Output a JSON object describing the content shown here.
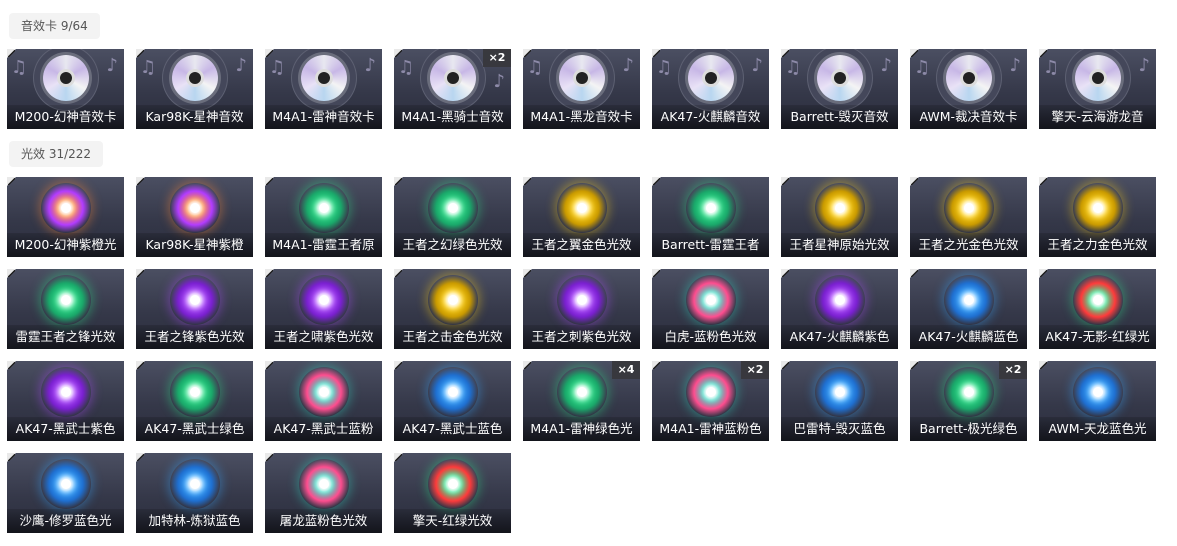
{
  "sections": [
    {
      "title": "音效卡 9/64",
      "kind": "sound",
      "items": [
        {
          "label": "M200-幻神音效卡",
          "badge": ""
        },
        {
          "label": "Kar98K-星神音效",
          "badge": ""
        },
        {
          "label": "M4A1-雷神音效卡",
          "badge": ""
        },
        {
          "label": "M4A1-黑骑士音效",
          "badge": "×2"
        },
        {
          "label": "M4A1-黑龙音效卡",
          "badge": ""
        },
        {
          "label": "AK47-火麒麟音效",
          "badge": ""
        },
        {
          "label": "Barrett-毁灭音效",
          "badge": ""
        },
        {
          "label": "AWM-裁决音效卡",
          "badge": ""
        },
        {
          "label": "擎天-云海游龙音",
          "badge": ""
        }
      ]
    },
    {
      "title": "光效 31/222",
      "kind": "light",
      "items": [
        {
          "label": "M200-幻神紫橙光",
          "badge": "",
          "color": "#ff8a3c",
          "color2": "#b23cff"
        },
        {
          "label": "Kar98K-星神紫橙",
          "badge": "",
          "color": "#ff8a3c",
          "color2": "#b23cff"
        },
        {
          "label": "M4A1-雷霆王者原",
          "badge": "",
          "color": "#2fe08a",
          "color2": "#1aa86a"
        },
        {
          "label": "王者之幻绿色光效",
          "badge": "",
          "color": "#2fe08a",
          "color2": "#1aa86a"
        },
        {
          "label": "王者之翼金色光效",
          "badge": "",
          "color": "#ffd21a",
          "color2": "#c99a00"
        },
        {
          "label": "Barrett-雷霆王者",
          "badge": "",
          "color": "#2fe08a",
          "color2": "#1aa86a"
        },
        {
          "label": "王者星神原始光效",
          "badge": "",
          "color": "#ffd21a",
          "color2": "#c99a00"
        },
        {
          "label": "王者之光金色光效",
          "badge": "",
          "color": "#ffd21a",
          "color2": "#c99a00"
        },
        {
          "label": "王者之力金色光效",
          "badge": "",
          "color": "#ffd21a",
          "color2": "#c99a00"
        },
        {
          "label": "雷霆王者之锋光效",
          "badge": "",
          "color": "#2fe08a",
          "color2": "#1aa86a"
        },
        {
          "label": "王者之锋紫色光效",
          "badge": "",
          "color": "#b04dff",
          "color2": "#7a20d0"
        },
        {
          "label": "王者之啸紫色光效",
          "badge": "",
          "color": "#b04dff",
          "color2": "#7a20d0"
        },
        {
          "label": "王者之击金色光效",
          "badge": "",
          "color": "#ffd21a",
          "color2": "#c99a00"
        },
        {
          "label": "王者之刺紫色光效",
          "badge": "",
          "color": "#b04dff",
          "color2": "#7a20d0"
        },
        {
          "label": "白虎-蓝粉色光效",
          "badge": "",
          "color": "#35d6c0",
          "color2": "#ff4d8f"
        },
        {
          "label": "AK47-火麒麟紫色",
          "badge": "",
          "color": "#b04dff",
          "color2": "#7a20d0"
        },
        {
          "label": "AK47-火麒麟蓝色",
          "badge": "",
          "color": "#3aa8ff",
          "color2": "#1f6fd0"
        },
        {
          "label": "AK47-无影-红绿光",
          "badge": "",
          "color": "#2fe08a",
          "color2": "#ff3b3b"
        },
        {
          "label": "AK47-黑武士紫色",
          "badge": "",
          "color": "#b04dff",
          "color2": "#7a20d0"
        },
        {
          "label": "AK47-黑武士绿色",
          "badge": "",
          "color": "#2fe08a",
          "color2": "#1aa86a"
        },
        {
          "label": "AK47-黑武士蓝粉",
          "badge": "",
          "color": "#35d6c0",
          "color2": "#ff4d8f"
        },
        {
          "label": "AK47-黑武士蓝色",
          "badge": "",
          "color": "#3aa8ff",
          "color2": "#1f6fd0"
        },
        {
          "label": "M4A1-雷神绿色光",
          "badge": "×4",
          "color": "#2fe08a",
          "color2": "#1aa86a"
        },
        {
          "label": "M4A1-雷神蓝粉色",
          "badge": "×2",
          "color": "#35d6c0",
          "color2": "#ff4d8f"
        },
        {
          "label": "巴雷特-毁灭蓝色",
          "badge": "",
          "color": "#3aa8ff",
          "color2": "#1f6fd0"
        },
        {
          "label": "Barrett-极光绿色",
          "badge": "×2",
          "color": "#2fe08a",
          "color2": "#1aa86a"
        },
        {
          "label": "AWM-天龙蓝色光",
          "badge": "",
          "color": "#3aa8ff",
          "color2": "#1f6fd0"
        },
        {
          "label": "沙鹰-修罗蓝色光",
          "badge": "",
          "color": "#3aa8ff",
          "color2": "#1f6fd0"
        },
        {
          "label": "加特林-炼狱蓝色",
          "badge": "",
          "color": "#3aa8ff",
          "color2": "#1f6fd0"
        },
        {
          "label": "屠龙蓝粉色光效",
          "badge": "",
          "color": "#35d6c0",
          "color2": "#ff4d8f"
        },
        {
          "label": "擎天-红绿光效",
          "badge": "",
          "color": "#2fe08a",
          "color2": "#ff3b3b"
        }
      ]
    }
  ]
}
